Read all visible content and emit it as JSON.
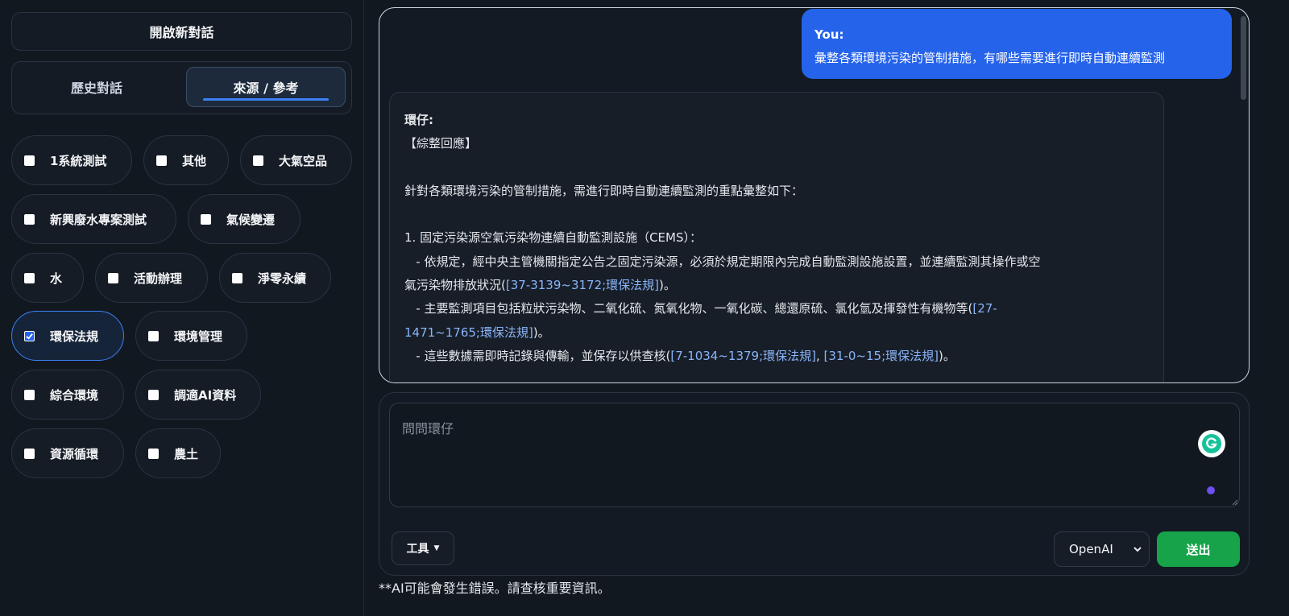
{
  "sidebar": {
    "new_chat_label": "開啟新對話",
    "tabs": [
      {
        "label": "歷史對話",
        "active": false
      },
      {
        "label": "來源 / 參考",
        "active": true
      }
    ],
    "filters": [
      {
        "label": "1系統測試",
        "checked": false
      },
      {
        "label": "其他",
        "checked": false
      },
      {
        "label": "大氣空品",
        "checked": false
      },
      {
        "label": "新興廢水專案測試",
        "checked": false
      },
      {
        "label": "氣候變遷",
        "checked": false
      },
      {
        "label": "水",
        "checked": false
      },
      {
        "label": "活動辦理",
        "checked": false
      },
      {
        "label": "淨零永續",
        "checked": false
      },
      {
        "label": "環保法規",
        "checked": true
      },
      {
        "label": "環境管理",
        "checked": false
      },
      {
        "label": "綜合環境",
        "checked": false
      },
      {
        "label": "調適AI資料",
        "checked": false
      },
      {
        "label": "資源循環",
        "checked": false
      },
      {
        "label": "農土",
        "checked": false
      }
    ]
  },
  "chat": {
    "user_message": {
      "sender": "You:",
      "text": "彙整各類環境污染的管制措施，有哪些需要進行即時自動連續監測"
    },
    "bot_message": {
      "sender": "環仔:",
      "heading": "【綜整回應】",
      "intro": "針對各類環境污染的管制措施，需進行即時自動連續監測的重點彙整如下：",
      "section_title": "1. 固定污染源空氣污染物連續自動監測設施（CEMS）：",
      "b1_text_a": "   - 依規定，經中央主管機關指定公告之固定污染源，必須於規定期限內完成自動監測設施設置，並連續監測其操作或空",
      "b1_text_b": "氣污染物排放狀況(",
      "b1_cite": "[37-3139~3172;環保法規]",
      "b1_end": ")。",
      "b2_text": "   - 主要監測項目包括粒狀污染物、二氧化硫、氮氧化物、一氧化碳、總還原硫、氯化氫及揮發性有機物等(",
      "b2_cite_a": "[27-",
      "b2_cite_b": "1471~1765;環保法規]",
      "b2_end": ")。",
      "b3_text": "   - 這些數據需即時記錄與傳輸，並保存以供查核(",
      "b3_cite_1": "[7-1034~1379;環保法規]",
      "b3_sep": ", ",
      "b3_cite_2": "[31-0~15;環保法規]",
      "b3_end": ")。"
    }
  },
  "composer": {
    "placeholder": "問問環仔",
    "tools_label": "工具",
    "model_value": "OpenAI",
    "send_label": "送出"
  },
  "disclaimer": "**AI可能會發生錯誤。請查核重要資訊。",
  "colors": {
    "background": "#111820",
    "accent_blue": "#2563eb",
    "send_green": "#16a34a",
    "citation": "#8ab4f8"
  }
}
